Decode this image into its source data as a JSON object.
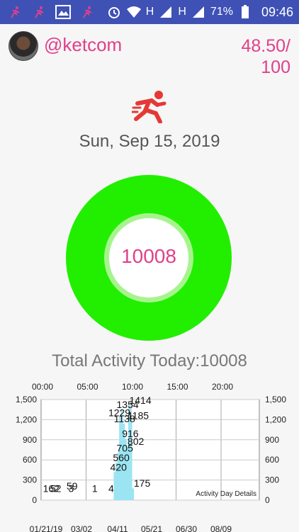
{
  "status_bar": {
    "left_icons": [
      "runner-icon",
      "runner-icon",
      "gallery-icon",
      "runner-icon"
    ],
    "right_icons": [
      "alarm-icon",
      "wifi-icon",
      "signal-icon",
      "signal-icon",
      "battery-icon"
    ],
    "network1": "H",
    "network2": "H",
    "battery": "71%",
    "time": "09:46"
  },
  "header": {
    "username": "@ketcom",
    "score_line1": "48.50/",
    "score_line2": "100"
  },
  "activity_icon": "runner-icon",
  "date": "Sun, Sep 15, 2019",
  "ring": {
    "value": "10008",
    "color": "#22ee00"
  },
  "total_label": "Total Activity Today:10008",
  "colors": {
    "accent": "#e0408a",
    "status_bar": "#3f51b5",
    "bars": "#9be5f3"
  },
  "chart_data": {
    "type": "bar",
    "description": "Activity Day Details",
    "top_axis_ticks": [
      "00:00",
      "05:00",
      "10:00",
      "15:00",
      "20:00"
    ],
    "bottom_axis_ticks": [
      "01/21/19",
      "03/02",
      "04/11",
      "05/21",
      "06/30",
      "08/09"
    ],
    "y_ticks": [
      "0",
      "300",
      "600",
      "900",
      "1,200",
      "1,500"
    ],
    "y_ticks_right": [
      "0",
      "300",
      "600",
      "900",
      "1,200",
      "1,500"
    ],
    "ylim": [
      0,
      1500
    ],
    "x_hours_lim": [
      0,
      24
    ],
    "bars": [
      {
        "x": 8.1,
        "value": 420
      },
      {
        "x": 8.3,
        "value": 560
      },
      {
        "x": 8.5,
        "value": 705
      },
      {
        "x": 8.7,
        "value": 1229
      },
      {
        "x": 8.9,
        "value": 1354
      },
      {
        "x": 9.1,
        "value": 1138
      },
      {
        "x": 9.3,
        "value": 916
      },
      {
        "x": 9.5,
        "value": 802
      },
      {
        "x": 9.7,
        "value": 1414
      },
      {
        "x": 9.9,
        "value": 1185
      },
      {
        "x": 10.1,
        "value": 175
      }
    ],
    "labels": [
      {
        "text": "162",
        "x": 0.2,
        "y": 120
      },
      {
        "text": "52",
        "x": 1.0,
        "y": 120
      },
      {
        "text": "3",
        "x": 3.0,
        "y": 120
      },
      {
        "text": "59",
        "x": 2.8,
        "y": 160
      },
      {
        "text": "1",
        "x": 5.6,
        "y": 120
      },
      {
        "text": "4",
        "x": 7.4,
        "y": 120
      },
      {
        "text": "420",
        "x": 7.6,
        "y": 440
      },
      {
        "text": "560",
        "x": 7.9,
        "y": 580
      },
      {
        "text": "705",
        "x": 8.3,
        "y": 725
      },
      {
        "text": "916",
        "x": 8.9,
        "y": 940
      },
      {
        "text": "802",
        "x": 9.5,
        "y": 825
      },
      {
        "text": "1229",
        "x": 7.4,
        "y": 1250
      },
      {
        "text": "1354",
        "x": 8.3,
        "y": 1375
      },
      {
        "text": "1138",
        "x": 8.0,
        "y": 1160
      },
      {
        "text": "1185",
        "x": 9.5,
        "y": 1210
      },
      {
        "text": "1414",
        "x": 9.7,
        "y": 1435
      },
      {
        "text": "175",
        "x": 10.2,
        "y": 200
      }
    ]
  }
}
